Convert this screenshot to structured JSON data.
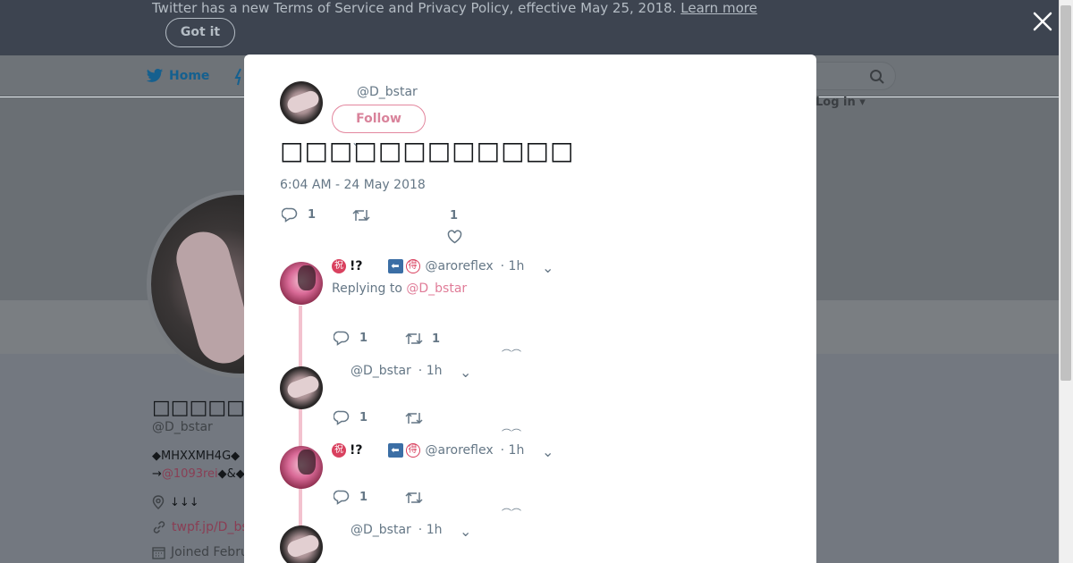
{
  "banner": {
    "text": "Twitter has a new Terms of Service and Privacy Policy, effective May 25, 2018.",
    "learn_more": "Learn more",
    "got_it": "Got it"
  },
  "nav": {
    "home": "Home",
    "login": "Log in"
  },
  "profile": {
    "name": "□□□□□□",
    "handle": "@D_bstar",
    "bio_line1": "◆MHXXMH4G◆",
    "bio_line2_prefix": "→",
    "bio_mention": "@1093rei",
    "bio_line2_suffix": "◆&◆",
    "location": "↓↓↓",
    "url": "twpf.jp/D_bs",
    "joined": "Joined Febru"
  },
  "modal": {
    "author_handle": "@D_bstar",
    "follow_label": "Follow",
    "tweet_text": "□□□□□□□□□□□□",
    "timestamp": "6:04 AM - 24 May 2018",
    "reply_count": "1",
    "like_count": "1",
    "replies": [
      {
        "badge1": "祝",
        "name_suffix": "!?",
        "arrow": "⬅",
        "badge2": "得",
        "handle": "@aroreflex",
        "time": "· 1h",
        "replying_to_label": "Replying to",
        "replying_to": "@D_bstar",
        "reply_count": "1",
        "retweet_count": "1"
      },
      {
        "handle": "@D_bstar",
        "time": "· 1h",
        "reply_count": "1"
      },
      {
        "badge1": "祝",
        "name_suffix": "!?",
        "arrow": "⬅",
        "badge2": "得",
        "handle": "@aroreflex",
        "time": "· 1h",
        "reply_count": "1"
      },
      {
        "handle": "@D_bstar",
        "time": "· 1h"
      }
    ]
  },
  "colors": {
    "banner_bg": "#3d4450",
    "accent_pink": "#e07c98",
    "brand_blue": "#1da1f2",
    "muted": "#657786"
  }
}
